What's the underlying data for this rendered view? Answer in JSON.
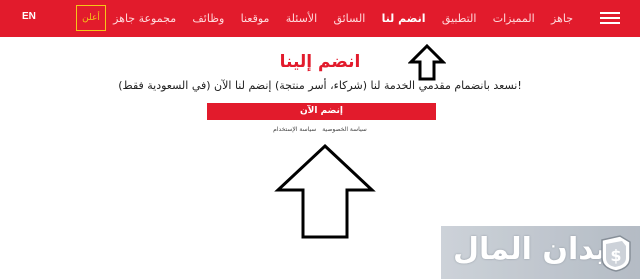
{
  "nav": {
    "lang": "EN",
    "ad_label": "أعلن",
    "links": [
      {
        "label": "جاهز",
        "active": false
      },
      {
        "label": "المميزات",
        "active": false
      },
      {
        "label": "التطبيق",
        "active": false
      },
      {
        "label": "انضم لنا",
        "active": true
      },
      {
        "label": "السائق",
        "active": false
      },
      {
        "label": "الأسئلة",
        "active": false
      },
      {
        "label": "موقعنا",
        "active": false
      },
      {
        "label": "وظائف",
        "active": false
      },
      {
        "label": "مجموعة جاهز",
        "active": false
      }
    ],
    "menu_icon": "hamburger-menu-icon"
  },
  "main": {
    "title": "انضم إلينا",
    "description": "!نسعد بانضمام مقدمي الخدمة لنا (شركاء، أسر منتجة) إنضم لنا الآن (في السعودية فقط)",
    "join_button": "إنضم الآن",
    "legal_privacy": "سياسة الخصوصية",
    "legal_terms": "سياسة الإستخدام"
  },
  "annotations": {
    "arrow_icon": "up-arrow-icon"
  },
  "watermark": {
    "text": "ميدان المال",
    "logo_icon": "dollar-shield-logo-icon"
  },
  "colors": {
    "brand_red": "#e21b2c",
    "ad_border": "#f5c518",
    "white": "#ffffff"
  }
}
